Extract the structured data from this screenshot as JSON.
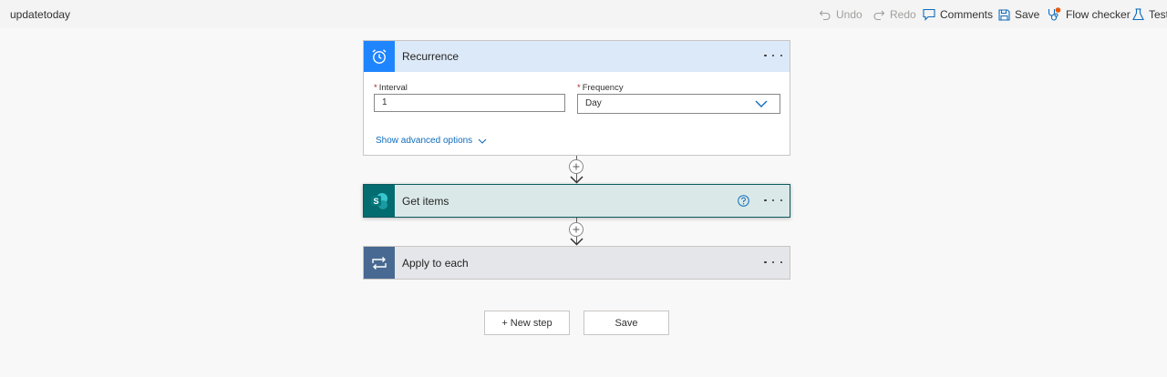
{
  "flow": {
    "name": "updatetoday"
  },
  "toolbar": {
    "undo": "Undo",
    "redo": "Redo",
    "comments": "Comments",
    "save": "Save",
    "flow_checker": "Flow checker",
    "test": "Test"
  },
  "steps": {
    "recurrence": {
      "title": "Recurrence",
      "interval_label": "Interval",
      "interval_value": "1",
      "frequency_label": "Frequency",
      "frequency_value": "Day",
      "advanced_link": "Show advanced options"
    },
    "get_items": {
      "title": "Get items",
      "icon_letter": "S"
    },
    "apply_to_each": {
      "title": "Apply to each"
    }
  },
  "actions": {
    "new_step": "+ New step",
    "save": "Save"
  },
  "colors": {
    "recurrence_header": "#dce9f8",
    "recurrence_icon": "#1f85ff",
    "get_items_header": "#dae9e8",
    "get_items_icon": "#036c70",
    "apply_header": "#e4e6ea",
    "apply_icon": "#486991",
    "checker_badge": "#e8590c"
  }
}
